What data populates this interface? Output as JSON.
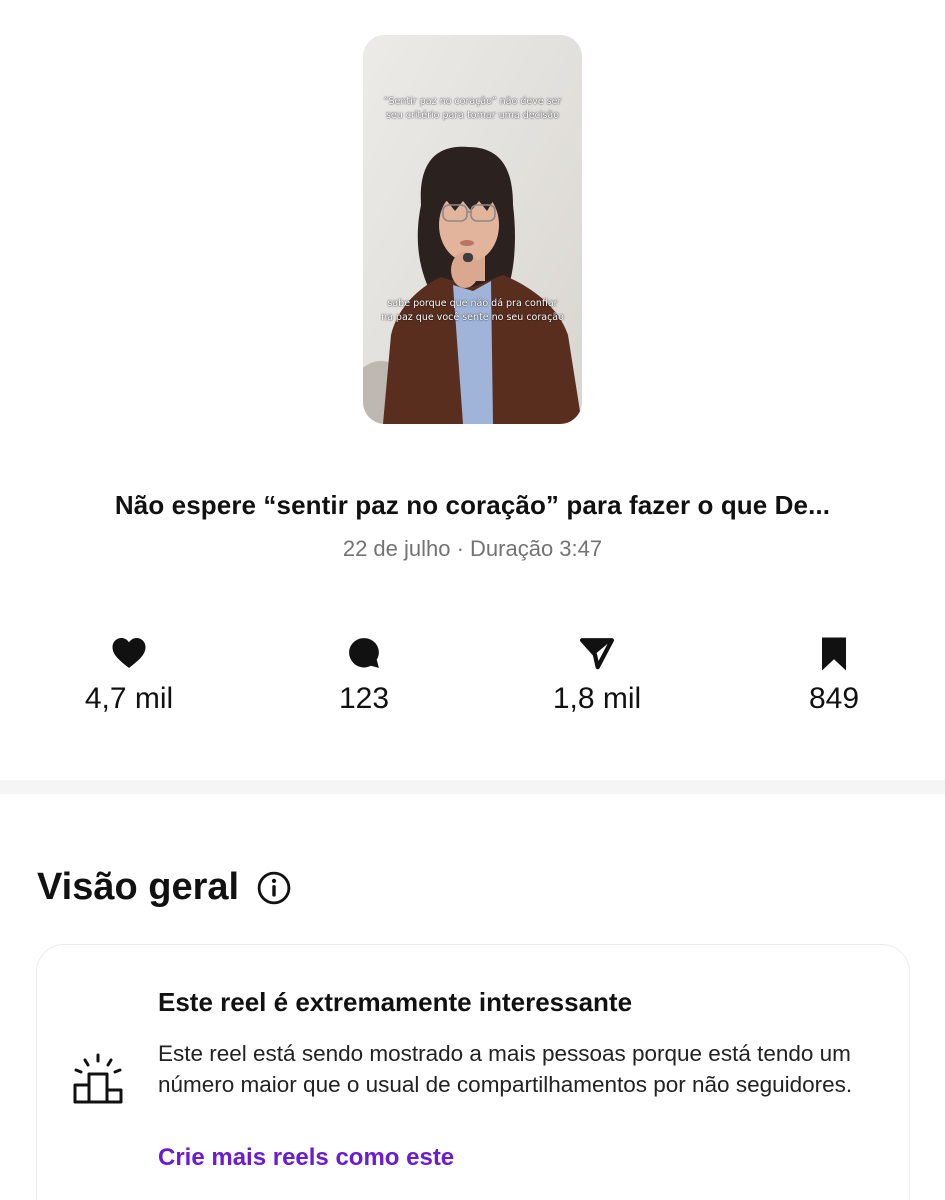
{
  "thumbnail": {
    "caption_top": "“Sentir paz no coração” não deve ser seu critério para tomar uma decisão",
    "caption_bottom": "sabe porque que não dá pra confiar na paz que você sente no seu coração"
  },
  "post": {
    "title": "Não espere “sentir paz no coração” para fazer o que De...",
    "meta": "22 de julho · Duração 3:47"
  },
  "stats": {
    "likes": "4,7 mil",
    "comments": "123",
    "shares": "1,8 mil",
    "saves": "849"
  },
  "overview": {
    "title": "Visão geral",
    "card": {
      "headline": "Este reel é extremamente interessante",
      "body": "Este reel está sendo mostrado a mais pessoas porque está tendo um número maior que o usual de compartilhamentos por não seguidores.",
      "link": "Crie mais reels como este"
    }
  },
  "colors": {
    "link": "#6a1bd8",
    "muted_text": "#737373",
    "separator": "#f5f5f5"
  }
}
